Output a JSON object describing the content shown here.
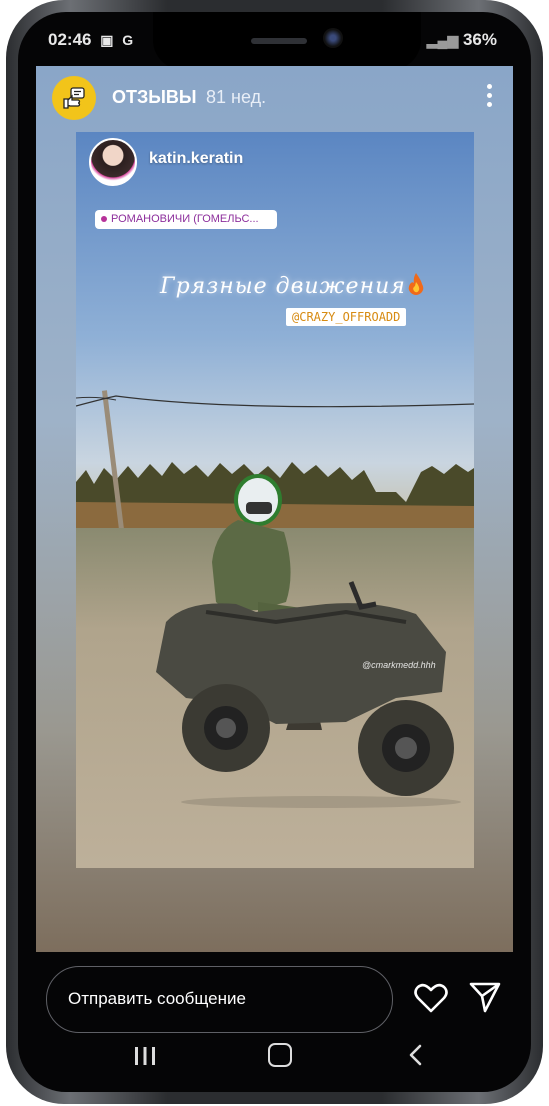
{
  "status_bar": {
    "time": "02:46",
    "battery": "36%"
  },
  "story": {
    "account_name": "ОТЗЫВЫ",
    "age": "81 нед.",
    "username": "katin.keratin",
    "location": "РОМАНОВИЧИ (ГОМЕЛЬС...",
    "caption": "Грязные движения",
    "mention": "@CRAZY_OFFROADD",
    "watermark": "@cmarkmedd.hhh"
  },
  "composer": {
    "placeholder": "Отправить сообщение"
  },
  "icons": {
    "logo": "thumbs-up-message-icon",
    "more": "more-vertical-icon",
    "heart": "heart-icon",
    "send": "send-icon",
    "recents": "recents-icon",
    "home": "home-icon",
    "back": "back-icon",
    "fire": "fire-emoji"
  },
  "colors": {
    "logo_bg": "#f2c41a",
    "location_text": "#8d2f9c",
    "mention_text": "#d78b12"
  }
}
